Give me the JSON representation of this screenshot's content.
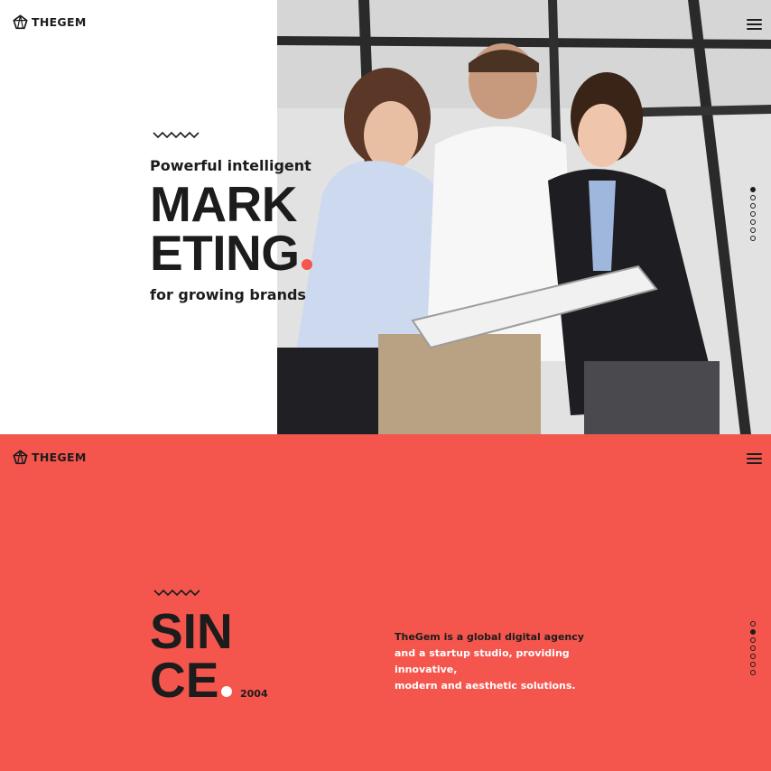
{
  "brand": {
    "name": "THEGEM",
    "accent_color": "#f4554d"
  },
  "hero": {
    "pre_title": "Powerful intelligent",
    "title_line1": "MARK",
    "title_line2": "ETING",
    "subtitle": "for growing brands",
    "menu_icon": "hamburger-menu-icon",
    "slide_nav": {
      "count": 7,
      "active_index": 0
    }
  },
  "since": {
    "background_color": "#f4554d",
    "title_line1": "SIN",
    "title_line2": "CE",
    "year": "2004",
    "description_line1": "TheGem is a global digital agency",
    "description_line2": "and a startup studio, providing innovative,",
    "description_line3": "modern and aesthetic solutions.",
    "menu_icon": "hamburger-menu-icon",
    "slide_nav": {
      "count": 7,
      "active_index": 1
    }
  }
}
